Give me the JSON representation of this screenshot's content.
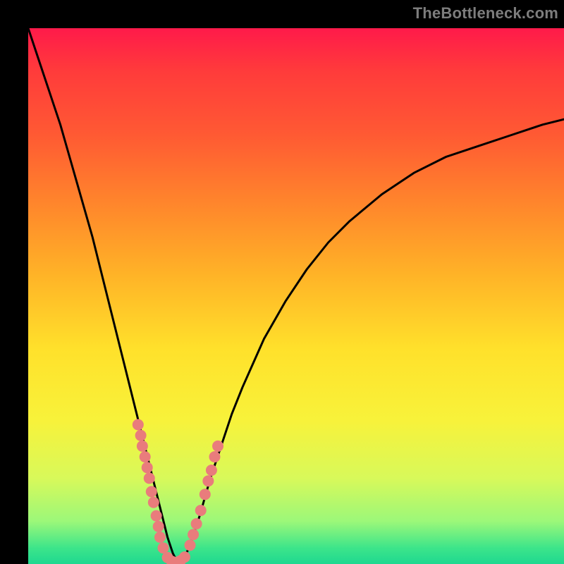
{
  "watermark": "TheBottleneck.com",
  "colors": {
    "frame": "#000000",
    "curve": "#000000",
    "marker_fill": "#e97c7c",
    "marker_stroke": "#c85a5a"
  },
  "chart_data": {
    "type": "line",
    "title": "",
    "xlabel": "",
    "ylabel": "",
    "xlim": [
      0,
      100
    ],
    "ylim": [
      0,
      100
    ],
    "grid": false,
    "legend": false,
    "series": [
      {
        "name": "bottleneck-curve",
        "x": [
          0,
          2,
          4,
          6,
          8,
          10,
          12,
          14,
          16,
          18,
          20,
          22,
          23,
          24,
          25,
          26,
          27,
          28,
          29,
          30,
          32,
          34,
          36,
          38,
          40,
          44,
          48,
          52,
          56,
          60,
          66,
          72,
          78,
          84,
          90,
          96,
          100
        ],
        "y": [
          100,
          94,
          88,
          82,
          75,
          68,
          61,
          53,
          45,
          37,
          29,
          21,
          17,
          13,
          9,
          5,
          2,
          0,
          1,
          3,
          9,
          16,
          22,
          28,
          33,
          42,
          49,
          55,
          60,
          64,
          69,
          73,
          76,
          78,
          80,
          82,
          83
        ]
      }
    ],
    "markers": {
      "name": "cluster-points",
      "points": [
        {
          "x": 20.5,
          "y": 26
        },
        {
          "x": 21.0,
          "y": 24
        },
        {
          "x": 21.3,
          "y": 22
        },
        {
          "x": 21.8,
          "y": 20
        },
        {
          "x": 22.2,
          "y": 18
        },
        {
          "x": 22.6,
          "y": 16
        },
        {
          "x": 23.0,
          "y": 13.5
        },
        {
          "x": 23.4,
          "y": 11.5
        },
        {
          "x": 23.9,
          "y": 9
        },
        {
          "x": 24.3,
          "y": 7
        },
        {
          "x": 24.6,
          "y": 5
        },
        {
          "x": 25.2,
          "y": 3
        },
        {
          "x": 26.0,
          "y": 1.2
        },
        {
          "x": 26.8,
          "y": 0.5
        },
        {
          "x": 27.6,
          "y": 0.3
        },
        {
          "x": 28.4,
          "y": 0.6
        },
        {
          "x": 29.2,
          "y": 1.3
        },
        {
          "x": 30.2,
          "y": 3.5
        },
        {
          "x": 30.8,
          "y": 5.5
        },
        {
          "x": 31.4,
          "y": 7.5
        },
        {
          "x": 32.2,
          "y": 10
        },
        {
          "x": 33.0,
          "y": 13
        },
        {
          "x": 33.6,
          "y": 15.5
        },
        {
          "x": 34.2,
          "y": 17.5
        },
        {
          "x": 34.8,
          "y": 20
        },
        {
          "x": 35.4,
          "y": 22
        }
      ]
    }
  }
}
